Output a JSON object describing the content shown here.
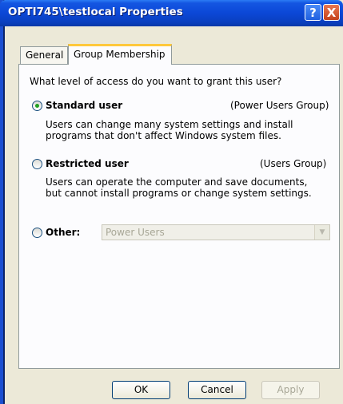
{
  "window": {
    "title": "OPTI745\\testlocal Properties",
    "help_glyph": "?",
    "close_glyph": "X"
  },
  "tabs": [
    {
      "label": "General",
      "selected": false
    },
    {
      "label": "Group Membership",
      "selected": true
    }
  ],
  "prompt": "What level of access do you want to grant this user?",
  "options": [
    {
      "label": "Standard user",
      "group": "(Power Users Group)",
      "selected": true,
      "description_lines": [
        "Users can change many system settings and install",
        "programs that don't affect Windows system files."
      ]
    },
    {
      "label": "Restricted user",
      "group": "(Users Group)",
      "selected": false,
      "description_lines": [
        "Users can operate the computer and save documents,",
        "but cannot install programs or change system settings."
      ]
    },
    {
      "label": "Other:",
      "selected": false,
      "dropdown_value": "Power Users"
    }
  ],
  "buttons": {
    "ok": "OK",
    "cancel": "Cancel",
    "apply": "Apply"
  },
  "colors": {
    "titlebar": "#0b47d6",
    "tab_highlight": "#ffc83c",
    "radio_dot": "#21a121"
  },
  "icons": {
    "help": "question-mark",
    "close": "x-close",
    "dropdown": "chevron-down"
  }
}
